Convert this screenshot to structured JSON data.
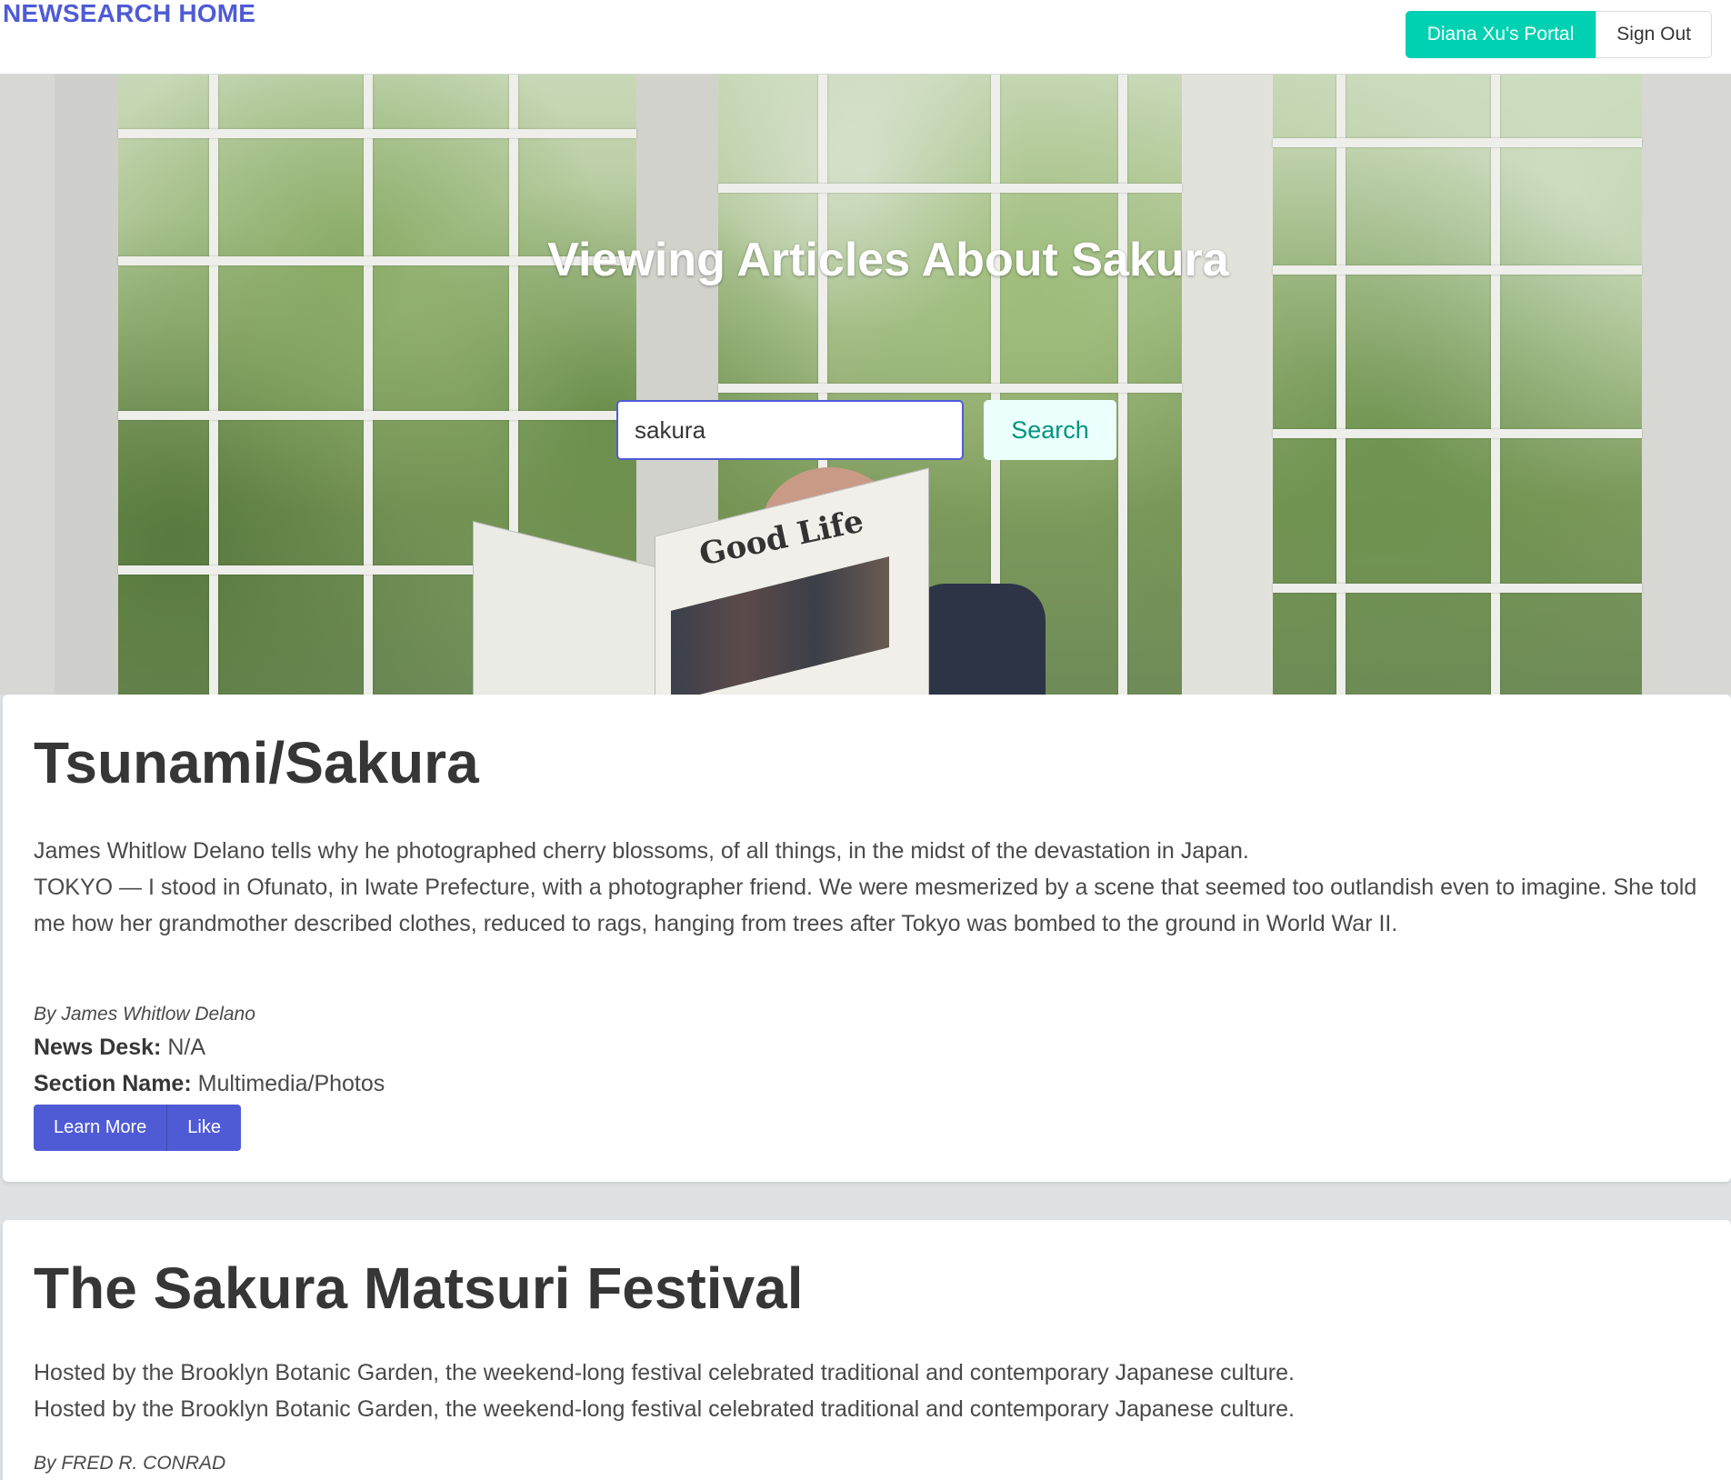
{
  "navbar": {
    "brand": "NEWSEARCH HOME",
    "portal_label": "Diana Xu's Portal",
    "signout_label": "Sign Out"
  },
  "hero": {
    "title": "Viewing Articles About Sakura",
    "search_value": "sakura",
    "search_button": "Search",
    "newspaper_masthead": "Good Life"
  },
  "articles": [
    {
      "title": "Tsunami/Sakura",
      "lines": [
        "James Whitlow Delano tells why he photographed cherry blossoms, of all things, in the midst of the devastation in Japan.",
        "TOKYO — I stood in Ofunato, in Iwate Prefecture, with a photographer friend. We were mesmerized by a scene that seemed too outlandish even to imagine. She told me how her grandmother described clothes, reduced to rags, hanging from trees after Tokyo was bombed to the ground in World War II."
      ],
      "byline": "By James Whitlow Delano",
      "news_desk_label": "News Desk:",
      "news_desk": "N/A",
      "section_label": "Section Name:",
      "section": "Multimedia/Photos",
      "learn_more": "Learn More",
      "like": "Like"
    },
    {
      "title": "The Sakura Matsuri Festival",
      "lines": [
        "Hosted by the Brooklyn Botanic Garden, the weekend-long festival celebrated traditional and contemporary Japanese culture.",
        "Hosted by the Brooklyn Botanic Garden, the weekend-long festival celebrated traditional and contemporary Japanese culture."
      ],
      "byline": "By FRED R. CONRAD"
    }
  ],
  "colors": {
    "brand": "#4f5bd5",
    "primary": "#00d1b2",
    "link_button": "#4f5bd5",
    "search_button_bg": "#ebfffc",
    "search_button_text": "#00947e"
  }
}
